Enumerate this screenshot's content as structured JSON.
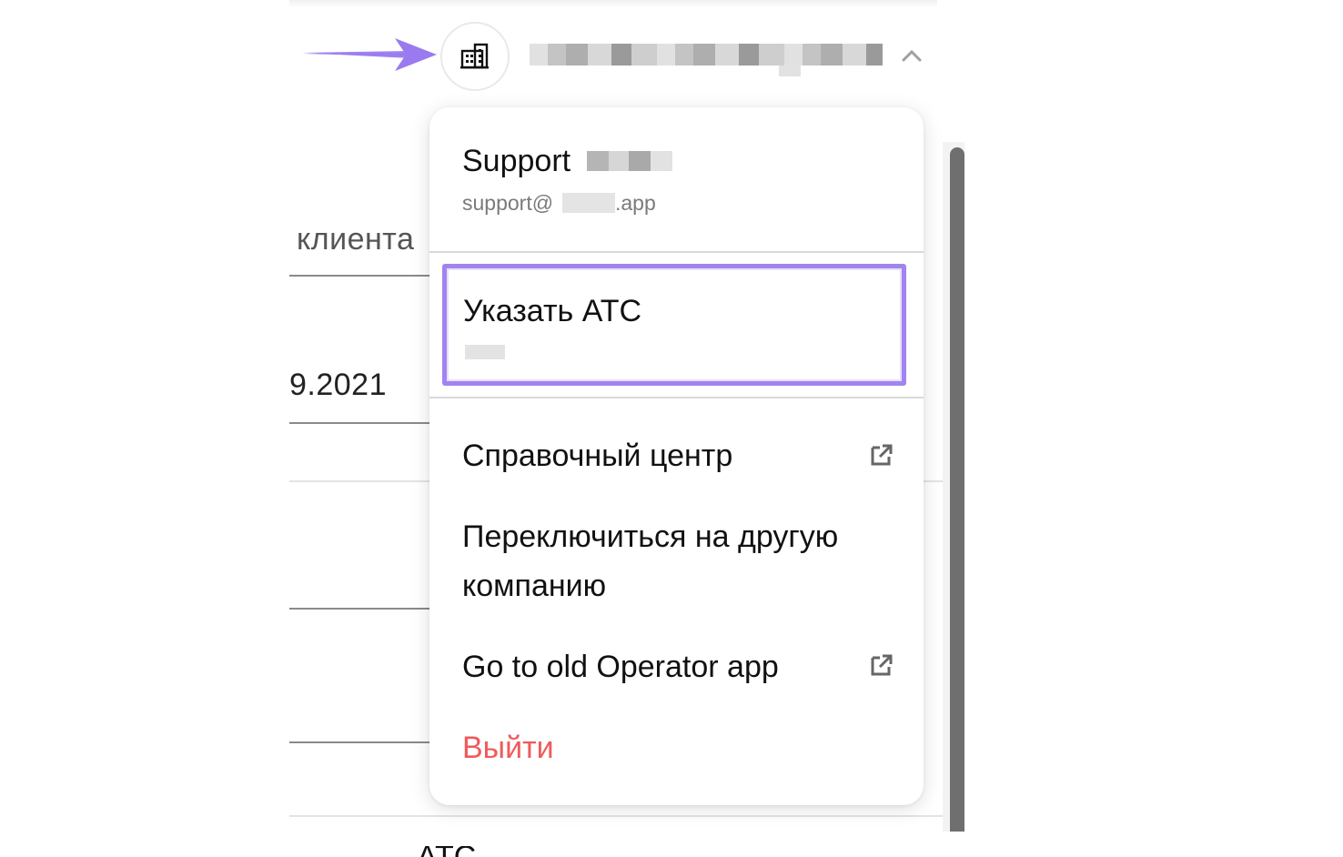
{
  "background": {
    "column_header": "клиента",
    "date_cell": "9.2021",
    "bottom_text": "АТС"
  },
  "header": {
    "company_icon": "building-icon",
    "expand_icon": "chevron-up-icon",
    "annotation_arrow_color": "#a184f0"
  },
  "menu": {
    "user_name": "Support",
    "user_email_prefix": "support@",
    "user_email_suffix": ".app",
    "select_pbx": {
      "label": "Указать АТС",
      "highlight_color": "#a184f0"
    },
    "items": [
      {
        "label": "Справочный центр",
        "icon": "external-link-icon"
      },
      {
        "label": "Переключиться на другую компанию"
      },
      {
        "label": "Go to old Operator app",
        "icon": "external-link-icon"
      }
    ],
    "logout": {
      "label": "Выйти",
      "color": "#ef5b5b"
    }
  }
}
